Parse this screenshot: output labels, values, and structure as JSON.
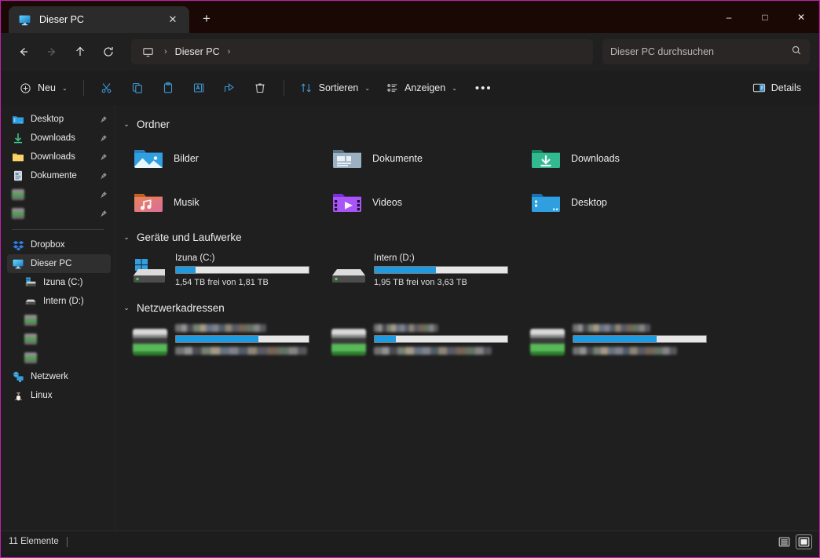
{
  "window": {
    "accent_border": "#c21fae",
    "titlebar_bg": "#190803",
    "controls": {
      "minimize": "–",
      "maximize": "□",
      "close": "✕"
    }
  },
  "tab": {
    "title": "Dieser PC",
    "icon": "this-pc-icon",
    "close_label": "✕",
    "new_tab_label": "+"
  },
  "nav": {
    "back": "←",
    "forward": "→",
    "up": "↑",
    "refresh": "⟳",
    "breadcrumb": {
      "root_icon": "monitor-icon",
      "sep": "›",
      "items": [
        "Dieser PC"
      ],
      "trailing_sep": "›"
    }
  },
  "search": {
    "placeholder": "Dieser PC durchsuchen",
    "value": "",
    "icon": "search-icon"
  },
  "toolbar": {
    "new_label": "Neu",
    "cut_label": "Ausschneiden",
    "copy_label": "Kopieren",
    "paste_label": "Einfügen",
    "rename_label": "Umbenennen",
    "share_label": "Freigeben",
    "delete_label": "Löschen",
    "sort_label": "Sortieren",
    "view_label": "Anzeigen",
    "more_label": "•••",
    "details_label": "Details",
    "chevron": "⌄"
  },
  "sidebar": {
    "items": [
      {
        "label": "Desktop",
        "icon": "desktop-folder-icon",
        "pinned": true,
        "blurred": false,
        "child": false,
        "selected": false
      },
      {
        "label": "Downloads",
        "icon": "downloads-arrow-icon",
        "pinned": true,
        "blurred": false,
        "child": false,
        "selected": false
      },
      {
        "label": "Downloads",
        "icon": "folder-icon",
        "pinned": true,
        "blurred": false,
        "child": false,
        "selected": false
      },
      {
        "label": "Dokumente",
        "icon": "documents-icon",
        "pinned": true,
        "blurred": false,
        "child": false,
        "selected": false
      },
      {
        "label": "",
        "icon": "blurred-icon",
        "pinned": true,
        "blurred": true,
        "child": false,
        "selected": false
      },
      {
        "label": "",
        "icon": "blurred-icon",
        "pinned": true,
        "blurred": true,
        "child": false,
        "selected": false
      }
    ],
    "items2": [
      {
        "label": "Dropbox",
        "icon": "dropbox-icon",
        "pinned": false,
        "blurred": false,
        "child": false,
        "selected": false
      },
      {
        "label": "Dieser PC",
        "icon": "this-pc-icon",
        "pinned": false,
        "blurred": false,
        "child": false,
        "selected": true
      },
      {
        "label": "Izuna (C:)",
        "icon": "windows-drive-icon",
        "pinned": false,
        "blurred": false,
        "child": true,
        "selected": false
      },
      {
        "label": "Intern (D:)",
        "icon": "drive-icon",
        "pinned": false,
        "blurred": false,
        "child": true,
        "selected": false
      },
      {
        "label": "",
        "icon": "blurred-network-icon",
        "pinned": false,
        "blurred": true,
        "child": true,
        "selected": false
      },
      {
        "label": "",
        "icon": "blurred-network-icon",
        "pinned": false,
        "blurred": true,
        "child": true,
        "selected": false
      },
      {
        "label": "",
        "icon": "blurred-network-icon",
        "pinned": false,
        "blurred": true,
        "child": true,
        "selected": false
      },
      {
        "label": "Netzwerk",
        "icon": "network-icon",
        "pinned": false,
        "blurred": false,
        "child": false,
        "selected": false
      },
      {
        "label": "Linux",
        "icon": "linux-penguin-icon",
        "pinned": false,
        "blurred": false,
        "child": false,
        "selected": false
      }
    ]
  },
  "main": {
    "groups": {
      "folders": {
        "title": "Ordner",
        "expanded": true,
        "items": [
          {
            "label": "Bilder",
            "icon": "pictures-folder-icon"
          },
          {
            "label": "Dokumente",
            "icon": "documents-folder-icon"
          },
          {
            "label": "Downloads",
            "icon": "downloads-folder-icon"
          },
          {
            "label": "Musik",
            "icon": "music-folder-icon"
          },
          {
            "label": "Videos",
            "icon": "videos-folder-icon"
          },
          {
            "label": "Desktop",
            "icon": "desktop-folder-icon"
          }
        ]
      },
      "drives": {
        "title": "Geräte und Laufwerke",
        "expanded": true,
        "items": [
          {
            "name": "Izuna (C:)",
            "sub": "1,54 TB frei von 1,81 TB",
            "used_percent": 15,
            "icon": "windows-drive-icon",
            "blurred": false
          },
          {
            "name": "Intern (D:)",
            "sub": "1,95 TB frei von 3,63 TB",
            "used_percent": 46,
            "icon": "drive-icon",
            "blurred": false
          }
        ]
      },
      "network": {
        "title": "Netzwerkadressen",
        "expanded": true,
        "items": [
          {
            "name": "",
            "sub": "",
            "used_percent": 62,
            "icon": "network-drive-icon",
            "blurred": true
          },
          {
            "name": "",
            "sub": "",
            "used_percent": 16,
            "icon": "network-drive-icon",
            "blurred": true
          },
          {
            "name": "",
            "sub": "",
            "used_percent": 63,
            "icon": "network-drive-icon",
            "blurred": true
          }
        ]
      }
    }
  },
  "status": {
    "count_text": "11 Elemente",
    "list_view_label": "Detailansicht",
    "tiles_view_label": "Große Symbole",
    "active_view": "tiles"
  },
  "colors": {
    "accent_blue": "#1e9be0",
    "window_bg": "#1f1f1f",
    "titlebar": "#190803",
    "border": "#c21fae"
  }
}
